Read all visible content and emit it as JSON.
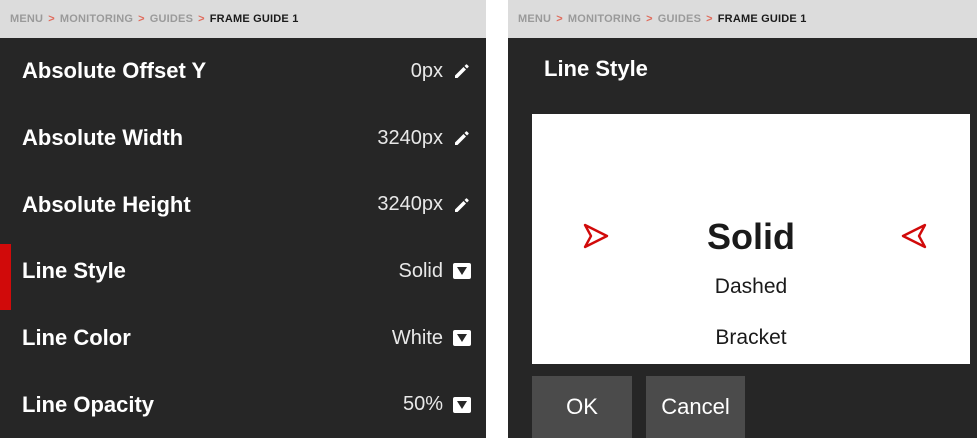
{
  "breadcrumb": {
    "items": [
      "MENU",
      "MONITORING",
      "GUIDES",
      "FRAME GUIDE 1"
    ],
    "separator": ">"
  },
  "settings": {
    "rows": [
      {
        "label": "Absolute Offset Y",
        "value": "0px",
        "icon": "pencil-icon"
      },
      {
        "label": "Absolute Width",
        "value": "3240px",
        "icon": "pencil-icon"
      },
      {
        "label": "Absolute Height",
        "value": "3240px",
        "icon": "pencil-icon"
      },
      {
        "label": "Line Style",
        "value": "Solid",
        "icon": "dropdown-icon",
        "selected": true
      },
      {
        "label": "Line Color",
        "value": "White",
        "icon": "dropdown-icon"
      },
      {
        "label": "Line Opacity",
        "value": "50%",
        "icon": "dropdown-icon"
      }
    ]
  },
  "dialog": {
    "title": "Line Style",
    "options": [
      "Solid",
      "Dashed",
      "Bracket"
    ],
    "selected": "Solid",
    "ok_label": "OK",
    "cancel_label": "Cancel"
  },
  "colors": {
    "panel_bg": "#262626",
    "breadcrumb_bg": "#dcdcdc",
    "accent_red": "#d10a0a",
    "button_bg": "#4b4b4b"
  }
}
